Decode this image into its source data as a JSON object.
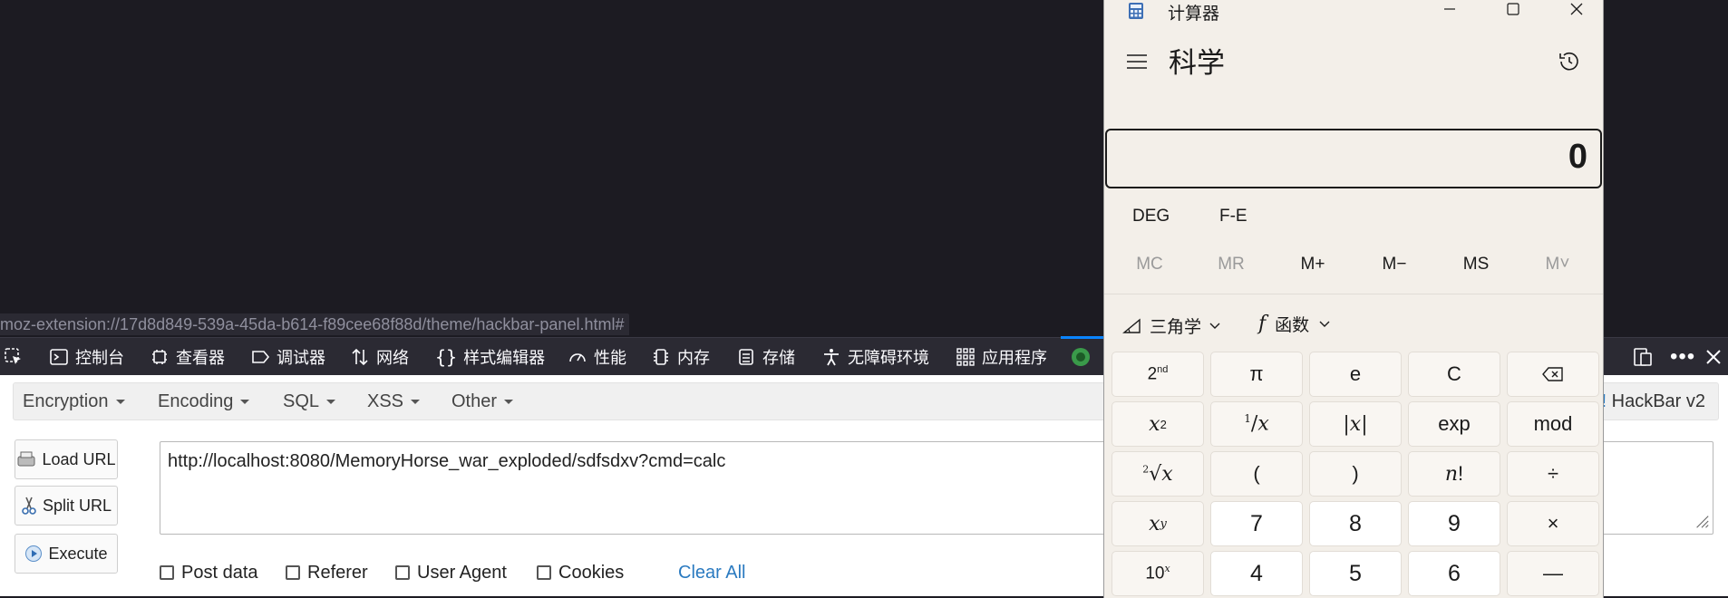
{
  "status_url": "moz-extension://17d8d849-539a-45da-b614-f89cee68f88d/theme/hackbar-panel.html#",
  "devtools": {
    "tabs": [
      {
        "label": "控制台",
        "icon": "console-icon"
      },
      {
        "label": "查看器",
        "icon": "inspector-icon"
      },
      {
        "label": "调试器",
        "icon": "debugger-icon"
      },
      {
        "label": "网络",
        "icon": "network-icon"
      },
      {
        "label": "样式编辑器",
        "icon": "style-editor-icon"
      },
      {
        "label": "性能",
        "icon": "performance-icon"
      },
      {
        "label": "内存",
        "icon": "memory-icon"
      },
      {
        "label": "存储",
        "icon": "storage-icon"
      },
      {
        "label": "无障碍环境",
        "icon": "accessibility-icon"
      },
      {
        "label": "应用程序",
        "icon": "application-icon"
      }
    ]
  },
  "hackbar": {
    "menu": [
      "Encryption",
      "Encoding",
      "SQL",
      "XSS",
      "Other"
    ],
    "brand": "HackBar v2",
    "buttons": {
      "load": "Load URL",
      "split": "Split URL",
      "execute": "Execute"
    },
    "url": "http://localhost:8080/MemoryHorse_war_exploded/sdfsdxv?cmd=calc",
    "options": [
      "Post data",
      "Referer",
      "User Agent",
      "Cookies"
    ],
    "clear_all": "Clear All"
  },
  "calculator": {
    "title": "计算器",
    "mode": "科学",
    "display": "0",
    "deg": "DEG",
    "fe": "F-E",
    "memory": [
      "MC",
      "MR",
      "M+",
      "M−",
      "MS",
      "M˅"
    ],
    "trig": "三角学",
    "func": "函数",
    "keys": {
      "pi": "π",
      "e": "e",
      "c": "C",
      "exp": "exp",
      "mod": "mod",
      "lparen": "(",
      "rparen": ")",
      "divide": "÷",
      "multiply": "×",
      "minus": "—",
      "n7": "7",
      "n8": "8",
      "n9": "9",
      "n4": "4",
      "n5": "5",
      "n6": "6"
    }
  }
}
